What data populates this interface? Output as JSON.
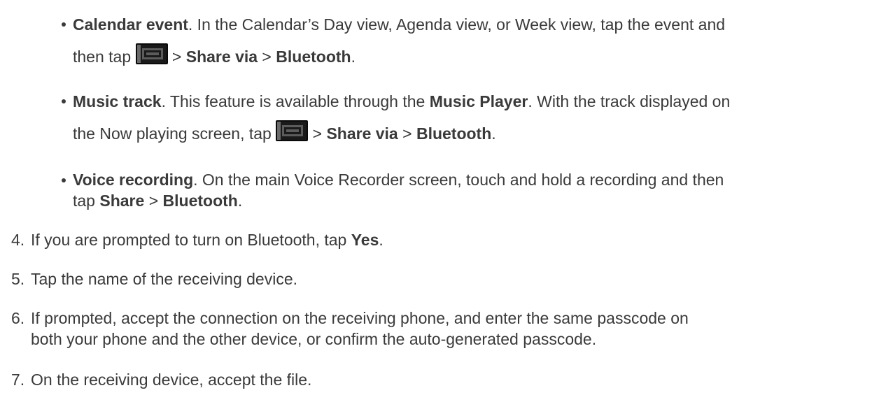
{
  "bullets": [
    {
      "title": "Calendar event",
      "text1": ". In the Calendar’s Day view, Agenda view, or Week view, tap the event and",
      "text2": "then tap ",
      "sep1": " > ",
      "bold1": "Share via",
      "sep2": " > ",
      "bold2": "Bluetooth",
      "end": "."
    },
    {
      "title": "Music track",
      "text1a": ". This feature is available through the ",
      "bold0": "Music Player",
      "text1b": ". With the track displayed on",
      "text2": "the Now playing screen, tap ",
      "sep1": " > ",
      "bold1": "Share via",
      "sep2": " > ",
      "bold2": "Bluetooth",
      "end": "."
    },
    {
      "title": "Voice recording",
      "text1": ". On the main Voice Recorder screen, touch and hold a recording and then",
      "text2": "tap ",
      "bold1": "Share",
      "sep1": " > ",
      "bold2": "Bluetooth",
      "end": "."
    }
  ],
  "steps": [
    {
      "num": "4.",
      "text": "If you are prompted to turn on Bluetooth, tap ",
      "bold": "Yes",
      "end": "."
    },
    {
      "num": "5.",
      "text": "Tap the name of the receiving device."
    },
    {
      "num": "6.",
      "line1": "If prompted, accept the connection on the receiving phone, and enter the same passcode on",
      "line2": "both your phone and the other device, or confirm the auto-generated passcode."
    },
    {
      "num": "7.",
      "text": "On the receiving device, accept the file."
    }
  ],
  "icons": {
    "menu": "menu-icon"
  }
}
